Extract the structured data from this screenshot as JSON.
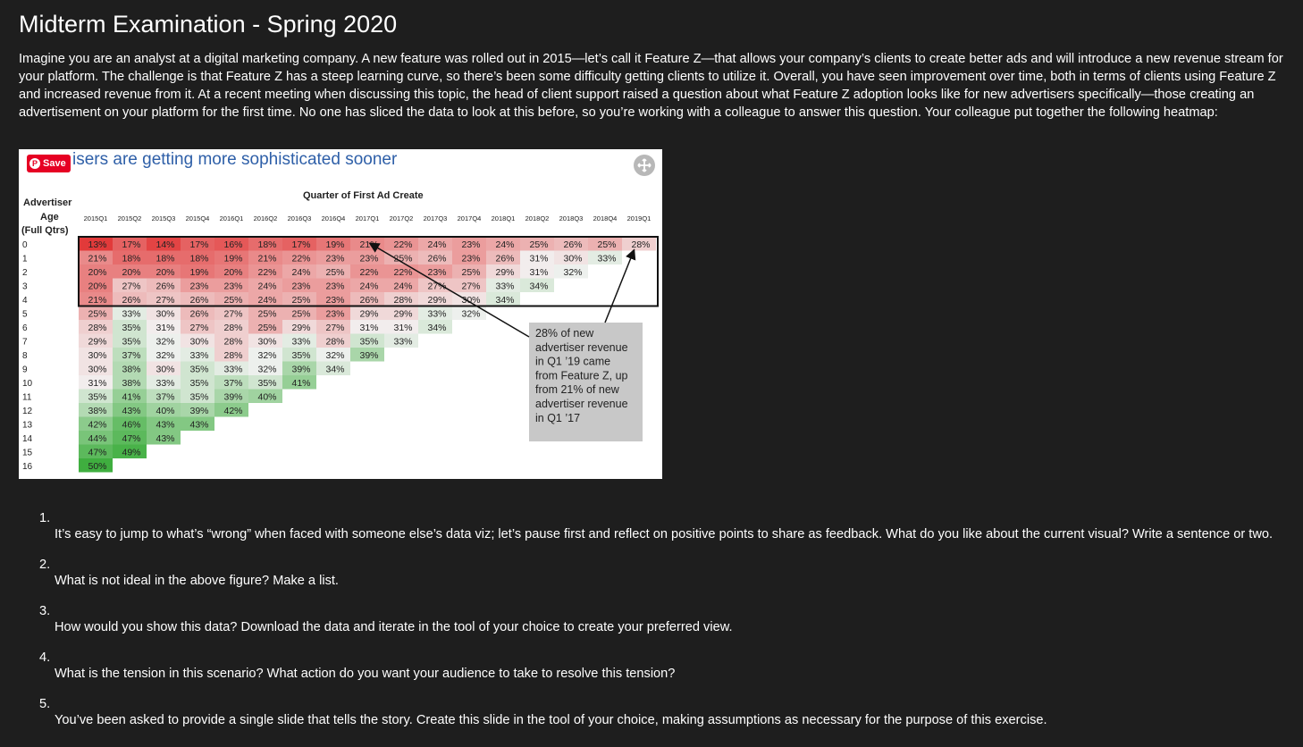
{
  "page": {
    "title": "Midterm Examination - Spring 2020",
    "intro": "Imagine you are an analyst at a digital marketing company. A new feature was rolled out in 2015—let’s call it Feature Z—that allows your company’s clients to create better ads and will introduce a new revenue stream for your platform. The challenge is that Feature Z has a steep learning curve, so there’s been some difficulty getting clients to utilize it. Overall, you have seen improvement over time, both in terms of clients using Feature Z and increased revenue from it. At a recent meeting when discussing this topic, the head of client support raised a question about what Feature Z adoption looks like for new advertisers specifically—those creating an advertisement on your platform for the first time. No one has sliced the data to look at this before, so you’re working with a colleague to answer this question. Your colleague put together the following heatmap:"
  },
  "figure": {
    "save_label": "Save",
    "save_icon": "pinterest-icon",
    "expand_icon": "expand-icon"
  },
  "questions": [
    {
      "number": "1.",
      "text": "It’s easy to jump to what’s “wrong” when faced with someone else’s data viz; let’s pause first and reflect on positive points to share as feedback. What do you like about the current visual? Write a sentence or two."
    },
    {
      "number": "2.",
      "text": "What is not ideal in the above figure? Make a list."
    },
    {
      "number": "3.",
      "text": "How would you show this data? Download the data and iterate in the tool of your choice to create your preferred view."
    },
    {
      "number": "4.",
      "text": "What is the tension in this scenario? What action do you want your audience to take to resolve this tension?"
    },
    {
      "number": "5.",
      "text": "You’ve been asked to provide a single slide that tells the story. Create this slide in the tool of your choice, making assumptions as necessary for the purpose of this exercise."
    }
  ],
  "chart_data": {
    "type": "heatmap",
    "title": "isers are getting more sophisticated sooner",
    "xlabel": "Quarter of First Ad Create",
    "ylabel_lines": [
      "Advertiser",
      "Age",
      "(Full Qtrs)"
    ],
    "x": [
      "2015Q1",
      "2015Q2",
      "2015Q3",
      "2015Q4",
      "2016Q1",
      "2016Q2",
      "2016Q3",
      "2016Q4",
      "2017Q1",
      "2017Q2",
      "2017Q3",
      "2017Q4",
      "2018Q1",
      "2018Q2",
      "2018Q3",
      "2018Q4",
      "2019Q1"
    ],
    "y": [
      "0",
      "1",
      "2",
      "3",
      "4",
      "5",
      "6",
      "7",
      "8",
      "9",
      "10",
      "11",
      "12",
      "13",
      "14",
      "15",
      "16"
    ],
    "values": [
      [
        13,
        17,
        14,
        17,
        16,
        18,
        17,
        19,
        21,
        22,
        24,
        23,
        24,
        25,
        26,
        25,
        28
      ],
      [
        21,
        18,
        18,
        18,
        19,
        21,
        22,
        23,
        23,
        25,
        26,
        23,
        26,
        31,
        30,
        33
      ],
      [
        20,
        20,
        20,
        19,
        20,
        22,
        24,
        25,
        22,
        22,
        23,
        25,
        29,
        31,
        32
      ],
      [
        20,
        27,
        26,
        23,
        23,
        24,
        23,
        23,
        24,
        24,
        27,
        27,
        33,
        34
      ],
      [
        21,
        26,
        27,
        26,
        25,
        24,
        25,
        23,
        26,
        28,
        29,
        30,
        34
      ],
      [
        25,
        33,
        30,
        26,
        27,
        25,
        25,
        23,
        29,
        29,
        33,
        32
      ],
      [
        28,
        35,
        31,
        27,
        28,
        25,
        29,
        27,
        31,
        31,
        34
      ],
      [
        29,
        35,
        32,
        30,
        28,
        30,
        33,
        28,
        35,
        33
      ],
      [
        30,
        37,
        32,
        33,
        28,
        32,
        35,
        32,
        39
      ],
      [
        30,
        38,
        30,
        35,
        33,
        32,
        39,
        34
      ],
      [
        31,
        38,
        33,
        35,
        37,
        35,
        41
      ],
      [
        35,
        41,
        37,
        35,
        39,
        40
      ],
      [
        38,
        43,
        40,
        39,
        42
      ],
      [
        42,
        46,
        43,
        43
      ],
      [
        44,
        47,
        43
      ],
      [
        47,
        49
      ],
      [
        50
      ]
    ],
    "value_suffix": "%",
    "annotation": "28% of new advertiser revenue in Q1 ’19 came from Feature Z, up from 21% of new advertiser revenue in Q1 ’17",
    "annotation_lines": [
      "28% of new",
      "advertiser revenue",
      "in Q1 ’19 came",
      "from Feature Z, up",
      "from 21% of new",
      "advertiser revenue",
      "in Q1 ’17"
    ],
    "highlight_rows": [
      "0",
      "1",
      "2",
      "3",
      "4"
    ],
    "colors": {
      "low": "#e23a3a",
      "mid": "#f2f2f2",
      "high": "#3fae3f"
    }
  }
}
